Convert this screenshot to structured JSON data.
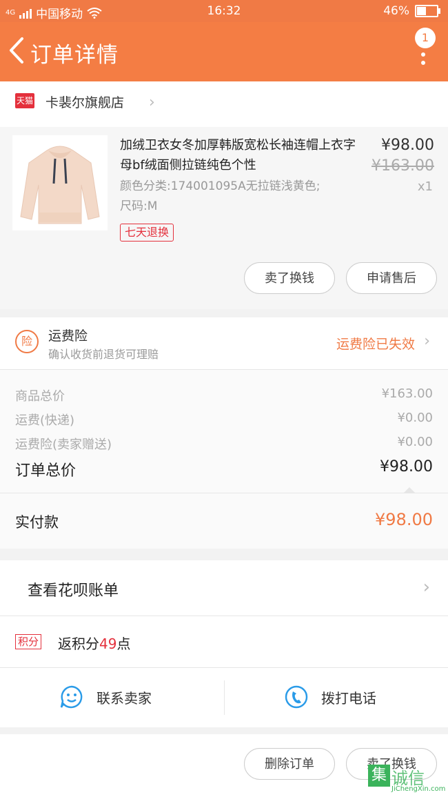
{
  "status_bar": {
    "network": "4G",
    "carrier": "中国移动",
    "time": "16:32",
    "battery": "46%",
    "battery_level": 0.46
  },
  "nav": {
    "title": "订单详情",
    "badge_count": "1"
  },
  "store": {
    "badge": "天猫",
    "name": "卡裴尔旗舰店"
  },
  "product": {
    "title": "加绒卫衣女冬加厚韩版宽松长袖连帽上衣字母bf绒面侧拉链纯色个性",
    "sku_line1": "颜色分类:174001095A无拉链浅黄色;",
    "sku_line2": "尺码:M",
    "tag": "七天退换",
    "price": "¥98.00",
    "original_price": "¥163.00",
    "quantity": "x1",
    "btn_remind": "卖了换钱",
    "btn_aftersale": "申请售后"
  },
  "insurance": {
    "icon_label": "险",
    "title": "运费险",
    "subtitle": "确认收货前退货可理赔",
    "status": "运费险已失效"
  },
  "summary": {
    "rows": [
      {
        "label": "商品总价",
        "value": "¥163.00"
      },
      {
        "label": "运费(快递)",
        "value": "¥0.00"
      },
      {
        "label": "运费险(卖家赠送)",
        "value": "¥0.00"
      }
    ],
    "total_label": "订单总价",
    "total_value": "¥98.00"
  },
  "paid": {
    "label": "实付款",
    "value": "¥98.00"
  },
  "huabei": {
    "label": "查看花呗账单"
  },
  "points": {
    "badge": "积分",
    "prefix": "返积分",
    "number": "49",
    "suffix": "点"
  },
  "contact": {
    "seller_label": "联系卖家",
    "phone_label": "拨打电话"
  },
  "actions": {
    "delete_label": "删除订单",
    "sell_label": "卖了换钱"
  },
  "watermark": {
    "box": "集",
    "cn": "诚信",
    "en": "JiChengXin.com"
  },
  "colors": {
    "accent": "#f47d44",
    "tmall_red": "#e4303c",
    "watermark_green": "#3bb35b"
  }
}
